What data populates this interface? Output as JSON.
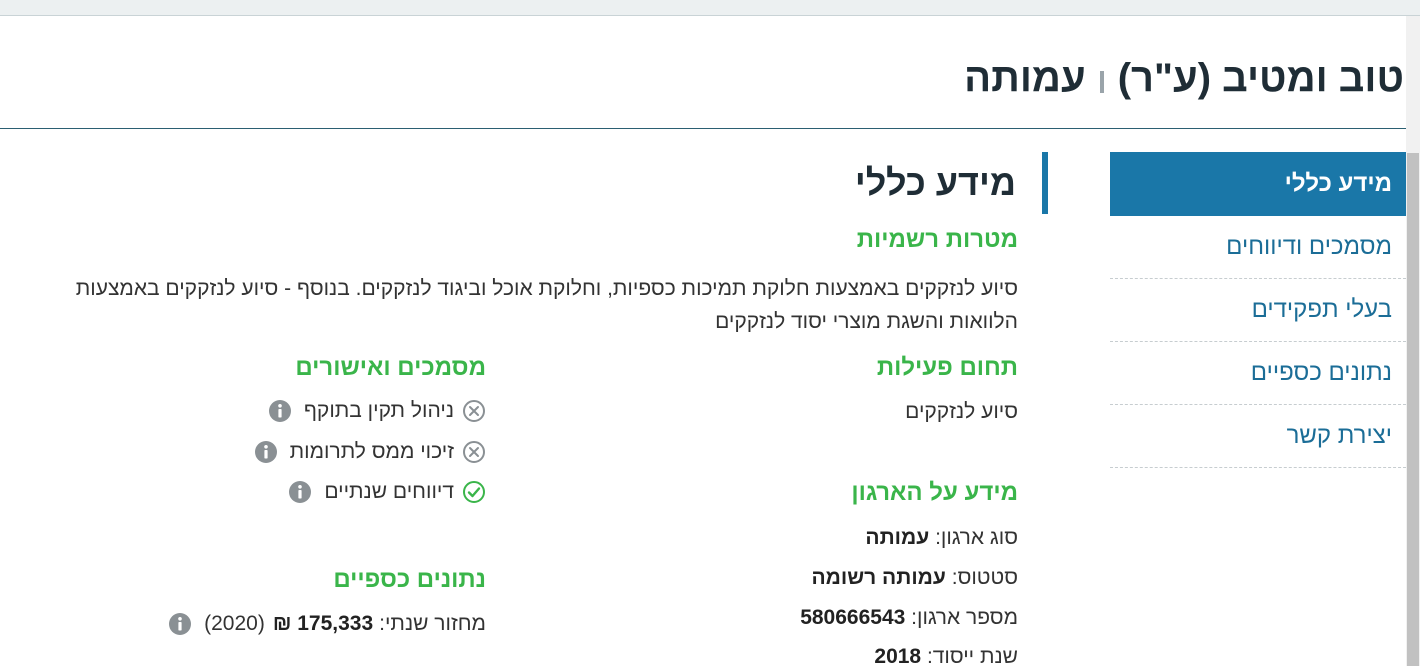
{
  "header": {
    "org_name": "טוב ומטיב (ע\"ר)",
    "org_type_tag": "עמותה"
  },
  "sidebar": {
    "items": [
      {
        "label": "מידע כללי",
        "active": true
      },
      {
        "label": "מסמכים ודיווחים",
        "active": false
      },
      {
        "label": "בעלי תפקידים",
        "active": false
      },
      {
        "label": "נתונים כספיים",
        "active": false
      },
      {
        "label": "יצירת קשר",
        "active": false
      }
    ]
  },
  "main": {
    "section_title": "מידע כללי",
    "purposes": {
      "heading": "מטרות רשמיות",
      "text": "סיוע לנזקקים באמצעות חלוקת תמיכות כספיות, וחלוקת אוכל וביגוד לנזקקים. בנוסף - סיוע לנזקקים באמצעות הלוואות והשגת מוצרי יסוד לנזקקים"
    },
    "activity": {
      "heading": "תחום פעילות",
      "value": "סיוע לנזקקים"
    },
    "org_info": {
      "heading": "מידע על הארגון",
      "rows": [
        {
          "label": "סוג ארגון:",
          "value": "עמותה"
        },
        {
          "label": "סטטוס:",
          "value": "עמותה רשומה"
        },
        {
          "label": "מספר ארגון:",
          "value": "580666543"
        },
        {
          "label": "שנת ייסוד:",
          "value": "2018"
        }
      ]
    },
    "documents": {
      "heading": "מסמכים ואישורים",
      "items": [
        {
          "label": "ניהול תקין בתוקף",
          "status": "missing",
          "status_icon": "x-circle-icon"
        },
        {
          "label": "זיכוי ממס לתרומות",
          "status": "missing",
          "status_icon": "x-circle-icon"
        },
        {
          "label": "דיווחים שנתיים",
          "status": "ok",
          "status_icon": "check-circle-icon"
        }
      ]
    },
    "financial": {
      "heading": "נתונים כספיים",
      "label": "מחזור שנתי:",
      "value": "175,333 ₪",
      "year": "(2020)"
    }
  },
  "colors": {
    "accent": "#1a77a8",
    "green": "#3ab54a",
    "gray_icon": "#8a9094"
  }
}
